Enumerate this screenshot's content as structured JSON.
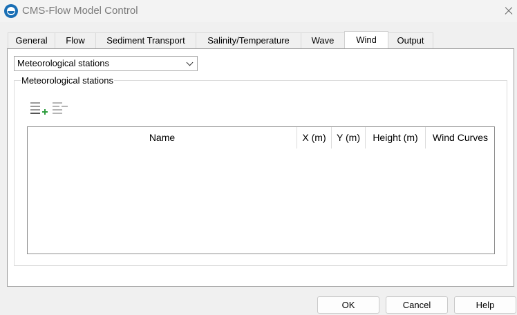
{
  "window": {
    "title": "CMS-Flow Model Control",
    "icon": "cms-flow-app-icon",
    "close_icon": "close-icon"
  },
  "tabs": [
    {
      "label": "General",
      "active": false
    },
    {
      "label": "Flow",
      "active": false
    },
    {
      "label": "Sediment Transport",
      "active": false
    },
    {
      "label": "Salinity/Temperature",
      "active": false
    },
    {
      "label": "Wave",
      "active": false
    },
    {
      "label": "Wind",
      "active": true
    },
    {
      "label": "Output",
      "active": false
    }
  ],
  "wind": {
    "dropdown_value": "Meteorological stations",
    "group_title": "Meteorological stations",
    "toolbar": {
      "add_icon": "add-row-icon",
      "remove_icon": "remove-row-icon"
    },
    "table": {
      "columns": [
        "Name",
        "X (m)",
        "Y (m)",
        "Height (m)",
        "Wind Curves"
      ],
      "rows": []
    }
  },
  "buttons": {
    "ok": "OK",
    "cancel": "Cancel",
    "help": "Help"
  },
  "colors": {
    "add_accent": "#2e9d3e",
    "app_icon": "#1a6fb5"
  }
}
